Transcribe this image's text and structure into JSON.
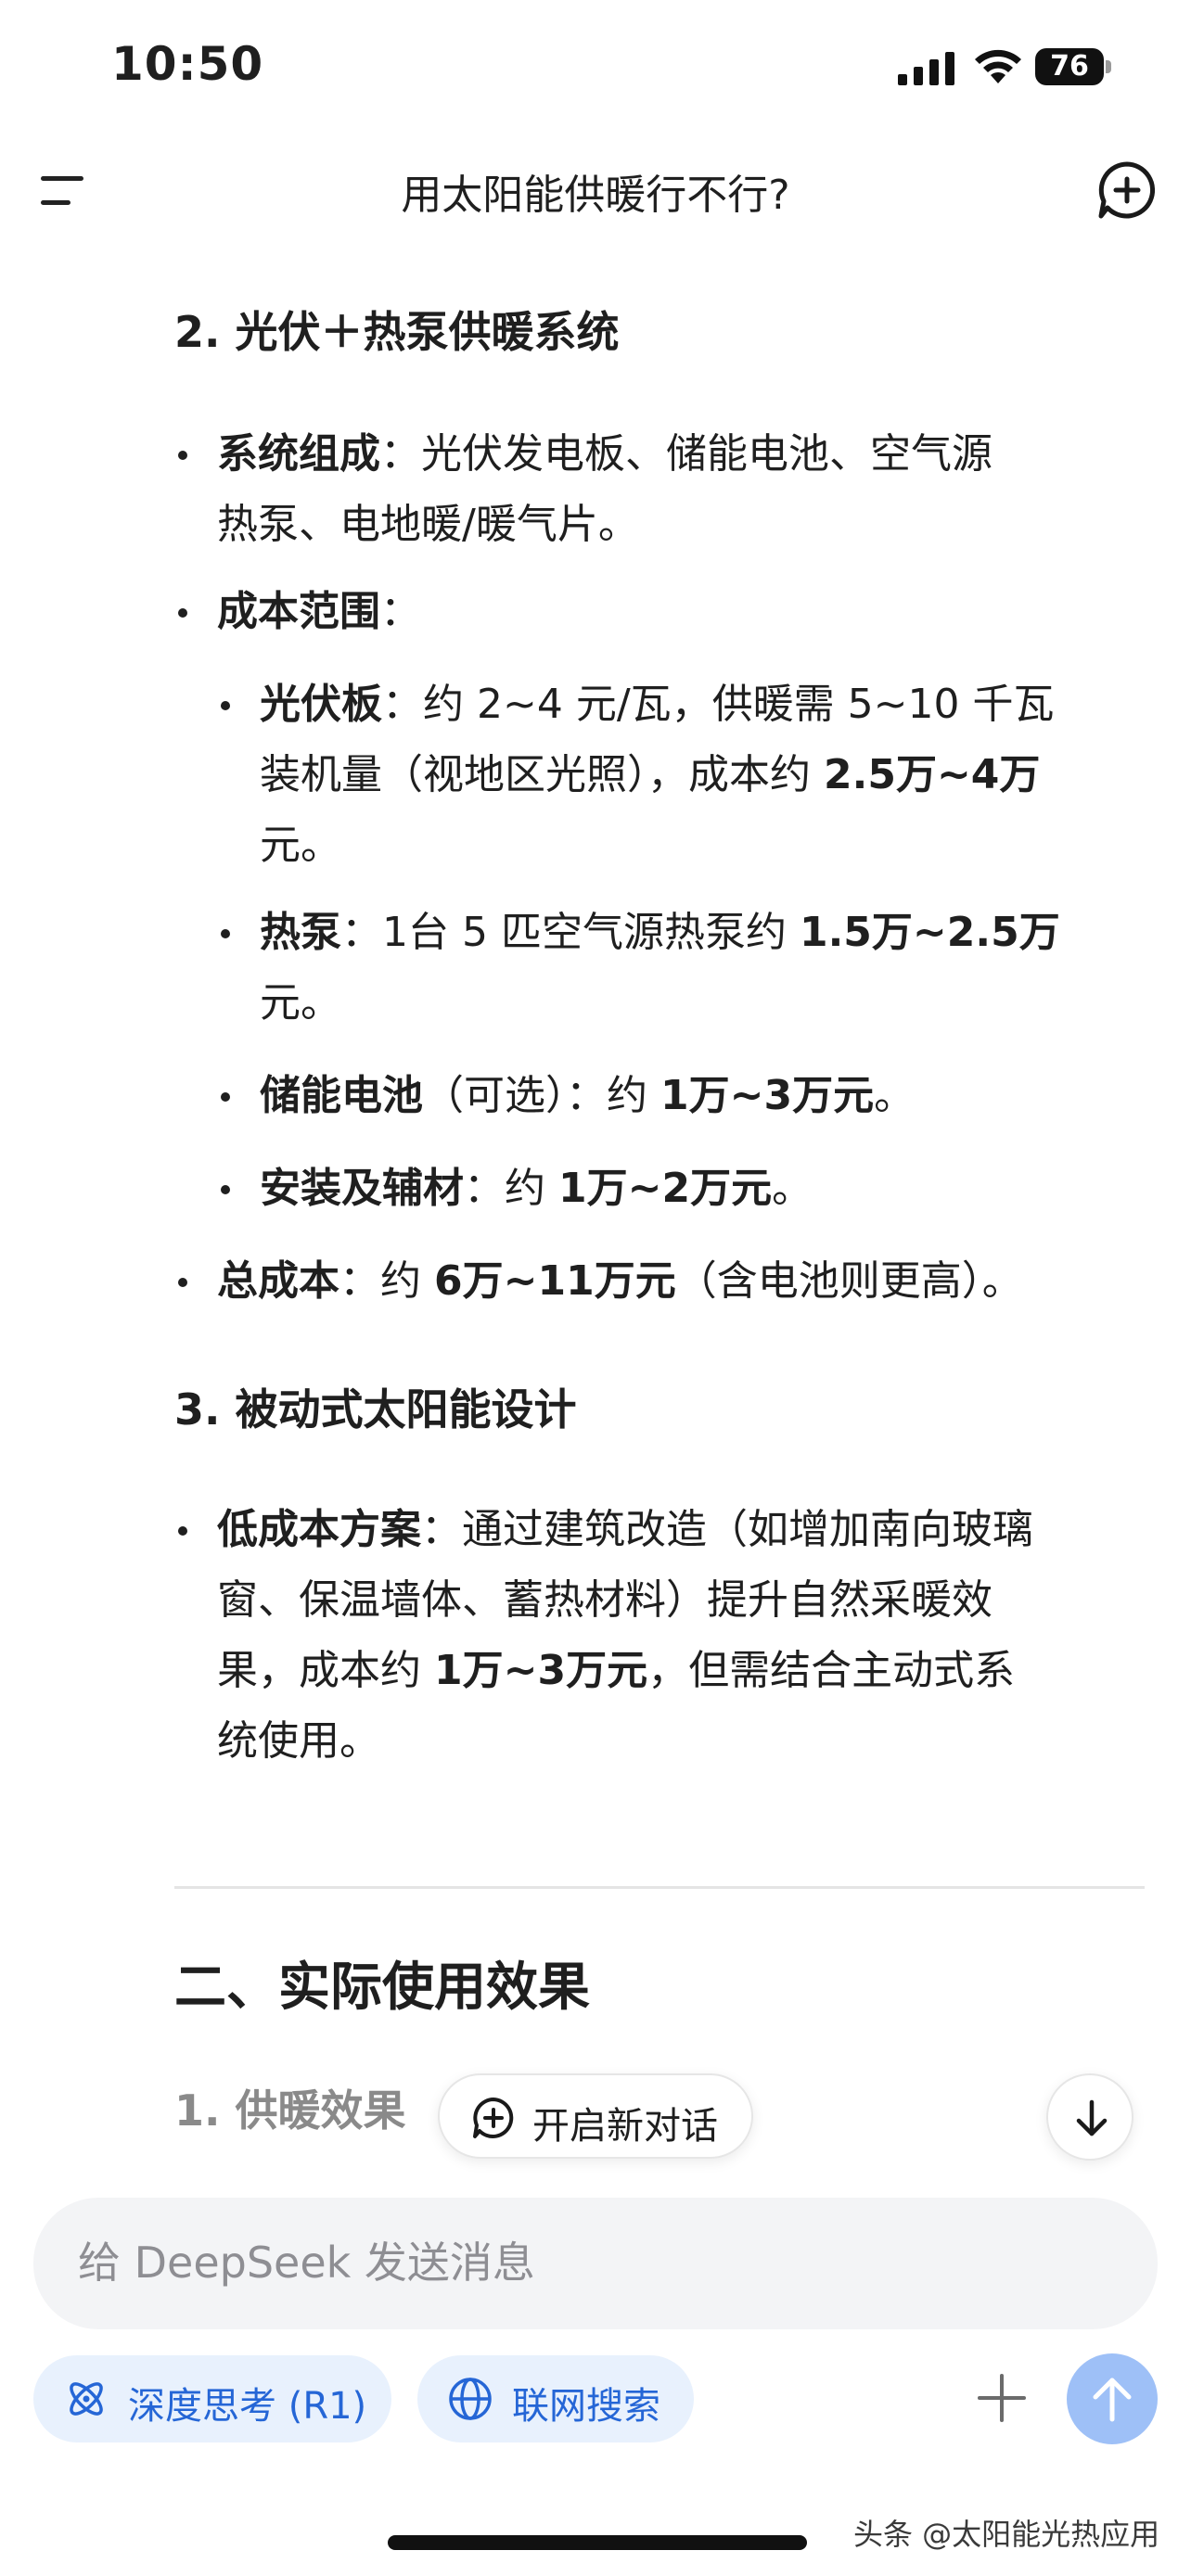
{
  "status_bar": {
    "time": "10:50",
    "battery": "76"
  },
  "nav": {
    "title": "用太阳能供暖行不行?"
  },
  "content": {
    "section2_heading": "2. 光伏＋热泵供暖系统",
    "sys_comp": {
      "label": "系统组成",
      "line1": "：光伏发电板、储能电池、空气源",
      "line2": "热泵、电地暖/暖气片。"
    },
    "cost_range": {
      "label": "成本范围",
      "suffix": "："
    },
    "pv_panel": {
      "label": "光伏板",
      "line1": "：约 2~4 元/瓦，供暖需 5~10 千瓦",
      "line2_pre": "装机量（视地区光照），成本约 ",
      "line2_bold": "2.5万~4万",
      "line3": "元。"
    },
    "heat_pump": {
      "label": "热泵",
      "line1_pre": "：1台 5 匹空气源热泵约 ",
      "line1_bold": "1.5万~2.5万",
      "line2": "元。"
    },
    "battery_item": {
      "label": "储能电池",
      "mid": "（可选）：约 ",
      "bold": "1万~3万元",
      "end": "。"
    },
    "install": {
      "label": "安装及辅材",
      "mid": "：约 ",
      "bold": "1万~2万元",
      "end": "。"
    },
    "total": {
      "label": "总成本",
      "mid": "：约 ",
      "bold": "6万~11万元",
      "end": "（含电池则更高）。"
    },
    "section3_heading": "3. 被动式太阳能设计",
    "passive": {
      "label": "低成本方案",
      "line1": "：通过建筑改造（如增加南向玻璃",
      "line2": "窗、保温墙体、蓄热材料）提升自然采暖效",
      "line3_pre": "果，成本约 ",
      "line3_bold": "1万~3万元",
      "line3_end": "，但需结合主动式系",
      "line4": "统使用。"
    },
    "part2_heading": "二、实际使用效果",
    "sub1_heading": "1. 供暖效果"
  },
  "floating": {
    "new_chat_label": "开启新对话"
  },
  "composer": {
    "placeholder": "给 DeepSeek 发送消息",
    "deep_think_label": "深度思考 (R1)",
    "web_search_label": "联网搜索"
  },
  "watermark": "头条 @太阳能光热应用",
  "colors": {
    "accent": "#2566d6",
    "chip_bg": "#e8f1fd",
    "send_disabled": "#9ec0f7",
    "composer_bg": "#f3f4f6"
  },
  "icons": [
    "signal-icon",
    "wifi-icon",
    "menu-icon",
    "new-chat-icon",
    "chevron-down-icon",
    "atom-icon",
    "globe-icon",
    "plus-icon",
    "arrow-up-icon"
  ]
}
